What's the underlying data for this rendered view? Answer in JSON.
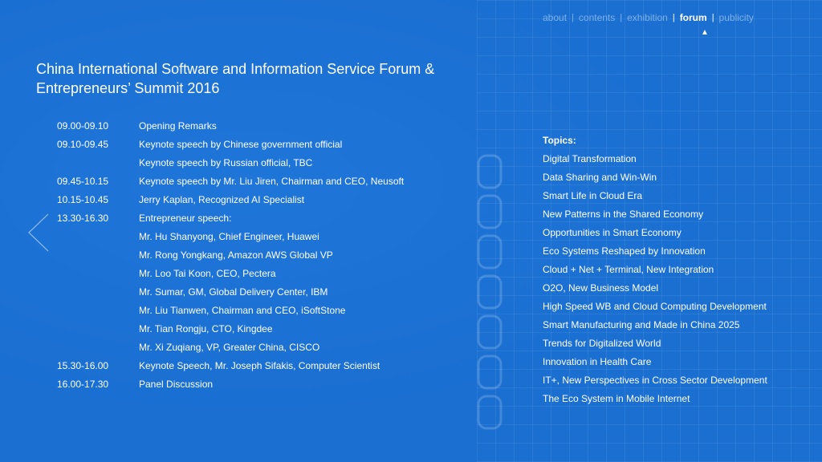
{
  "nav": {
    "items": [
      {
        "label": "about"
      },
      {
        "label": "contents"
      },
      {
        "label": "exhibition"
      },
      {
        "label": "forum"
      },
      {
        "label": "publicity"
      }
    ],
    "separator": "|",
    "active_indicator": "▲"
  },
  "page": {
    "title_line1": "China International Software and Information Service Forum &",
    "title_line2": "Entrepreneurs’ Summit 2016"
  },
  "schedule": [
    {
      "time": "09.00-09.10",
      "desc": "Opening Remarks"
    },
    {
      "time": "09.10-09.45",
      "desc": "Keynote speech by Chinese government official"
    },
    {
      "time": "",
      "desc": "Keynote speech by Russian official, TBC"
    },
    {
      "time": "09.45-10.15",
      "desc": "Keynote speech by Mr. Liu Jiren, Chairman and CEO, Neusoft"
    },
    {
      "time": "10.15-10.45",
      "desc": "Jerry Kaplan, Recognized AI Specialist"
    },
    {
      "time": "13.30-16.30",
      "desc": "Entrepreneur speech:"
    },
    {
      "time": "",
      "desc": "Mr. Hu Shanyong, Chief Engineer, Huawei"
    },
    {
      "time": "",
      "desc": "Mr. Rong Yongkang, Amazon AWS Global VP"
    },
    {
      "time": "",
      "desc": "Mr. Loo Tai Koon, CEO, Pectera"
    },
    {
      "time": "",
      "desc": "Mr. Sumar, GM, Global Delivery Center,  IBM"
    },
    {
      "time": "",
      "desc": "Mr. Liu Tianwen, Chairman and CEO, iSoftStone"
    },
    {
      "time": "",
      "desc": "Mr. Tian Rongju, CTO, Kingdee"
    },
    {
      "time": "",
      "desc": "Mr. Xi Zuqiang, VP, Greater China, CISCO"
    },
    {
      "time": "15.30-16.00",
      "desc": "Keynote Speech, Mr. Joseph Sifakis, Computer Scientist"
    },
    {
      "time": "16.00-17.30",
      "desc": "Panel Discussion"
    }
  ],
  "topics": {
    "heading": "Topics:",
    "items": [
      "Digital Transformation",
      "Data Sharing and Win-Win",
      "Smart Life in Cloud Era",
      "New Patterns in the Shared Economy",
      "Opportunities in Smart Economy",
      "Eco Systems Reshaped by Innovation",
      "Cloud + Net + Terminal, New Integration",
      "O2O, New Business Model",
      "High Speed WB and Cloud Computing Development",
      "Smart Manufacturing and Made in China 2025",
      "Trends for Digitalized World",
      "Innovation in Health Care",
      "IT+, New Perspectives in Cross Sector Development",
      "The Eco System in Mobile Internet"
    ]
  },
  "icons": {
    "back": "chevron-left-icon",
    "watermark": "decorative-watermark"
  },
  "colors": {
    "background": "#1a6fd1",
    "nav_inactive": "#7fb0e6",
    "text": "#ffffff"
  }
}
